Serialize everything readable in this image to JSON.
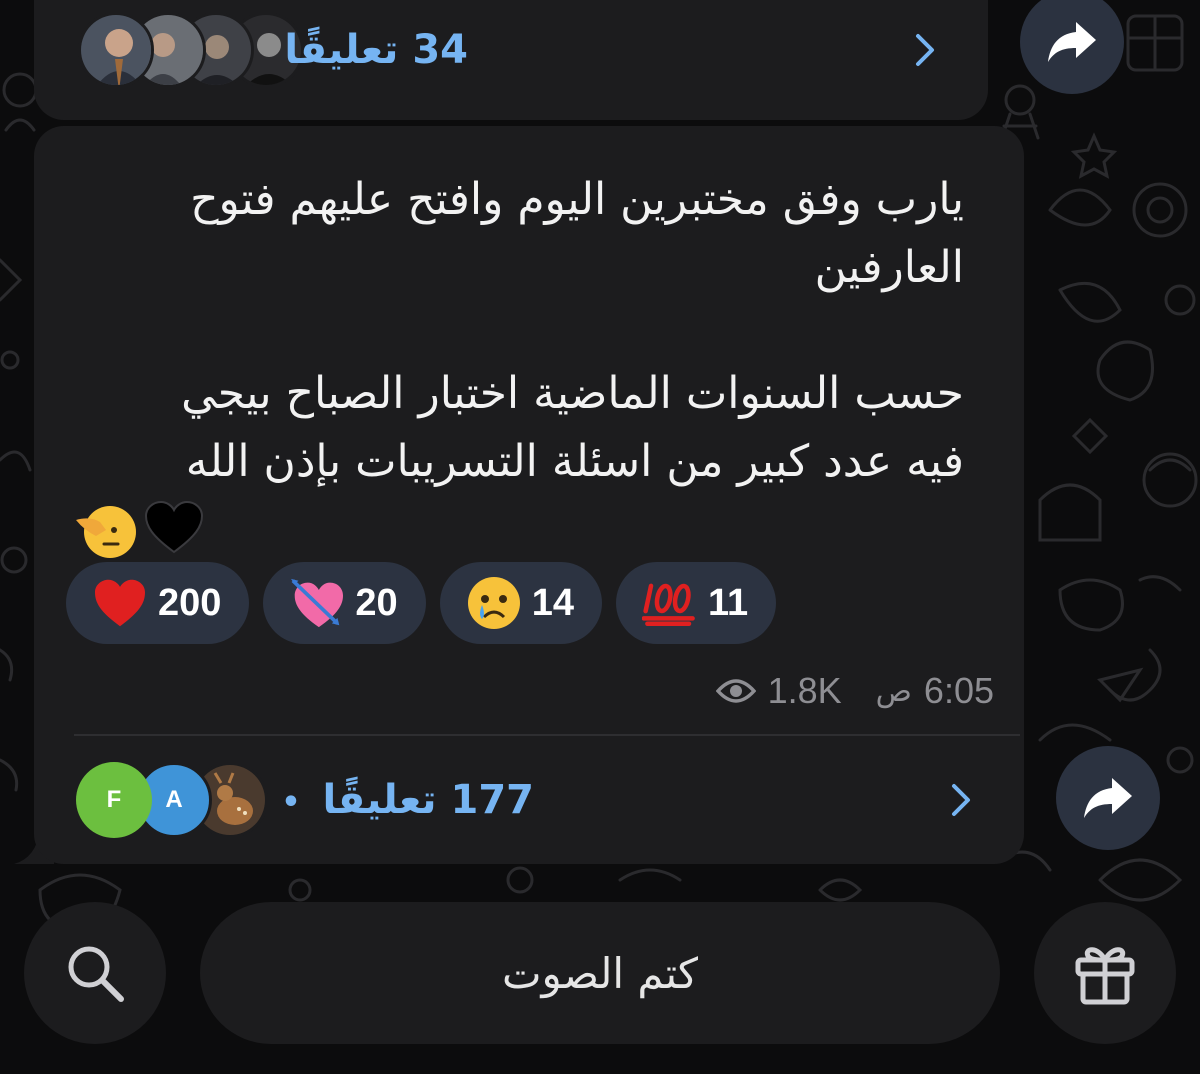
{
  "colors": {
    "bubble": "#1c1c1e",
    "accent_link": "#76b4f2",
    "reaction_pill": "#2c3341",
    "meta_gray": "#8e8e93",
    "share_button": "#2b3240"
  },
  "previous_post": {
    "comments_label": "34 تعليقًا",
    "avatars": [
      "photo-avatar",
      "photo-avatar",
      "photo-avatar",
      "photo-avatar"
    ]
  },
  "post": {
    "text_lines_1": [
      "يارب وفق مختبرين اليوم وافتح عليهم فتوح",
      "العارفين"
    ],
    "text_lines_2": [
      "حسب السنوات الماضية اختبار الصباح بيجي",
      "فيه عدد كبير من اسئلة التسريبات بإذن الله"
    ],
    "text_emoji_line": "🫡🖤",
    "reactions": [
      {
        "emoji": "red-heart",
        "count": "200"
      },
      {
        "emoji": "heart-with-arrow",
        "count": "20"
      },
      {
        "emoji": "crying-face",
        "count": "14"
      },
      {
        "emoji": "hundred-points",
        "count": "11"
      }
    ],
    "views": "1.8K",
    "time": "6:05",
    "ampm": "ص",
    "comments_label": "177 تعليقًا",
    "comment_avatars": [
      {
        "letter": "F",
        "color": "#6cbf3f"
      },
      {
        "letter": "A",
        "color": "#3f94d8"
      },
      {
        "letter": "",
        "color": "#5a4a3a"
      }
    ]
  },
  "bottom_bar": {
    "mute_label": "كتم الصوت",
    "search_icon": "search-icon",
    "gift_icon": "gift-icon"
  }
}
